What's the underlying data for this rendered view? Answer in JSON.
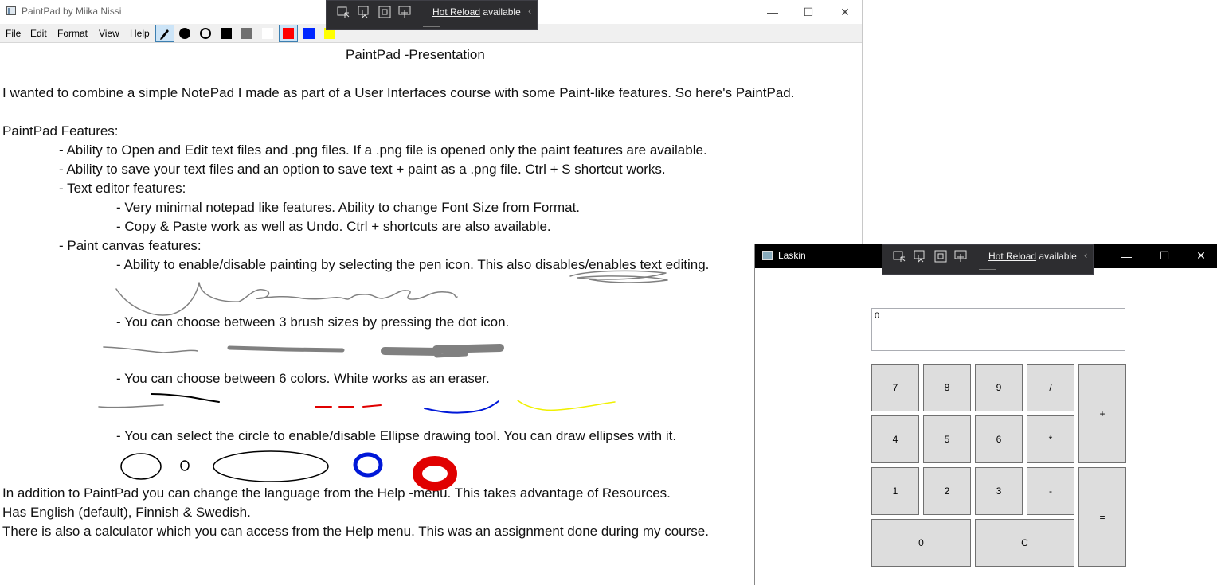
{
  "paintpad": {
    "window_title": "PaintPad by Miika Nissi",
    "controls": {
      "minimize": "—",
      "maximize": "☐",
      "close": "✕"
    },
    "menu": [
      "File",
      "Edit",
      "Format",
      "View",
      "Help"
    ],
    "tools": {
      "pen": "pen-icon",
      "brush_size": "dot-icon",
      "ellipse": "circle-icon",
      "colors": [
        "#000000",
        "#707070",
        "#ffffff",
        "#ff0000",
        "#0026ff",
        "#ffff00"
      ],
      "selected_color": "#ff0000"
    },
    "document": {
      "heading": "PaintPad -Presentation",
      "lines": [
        "I wanted to combine a simple NotePad I made as part of a User Interfaces course with some Paint-like features. So here's PaintPad.",
        "PaintPad Features:",
        "- Ability to Open and Edit text files and .png files. If a .png file is opened only the paint features are available.",
        "- Ability to save your text files and an option to save text + paint as a .png file. Ctrl + S shortcut works.",
        "- Text editor features:",
        "- Very minimal notepad like features. Ability to change Font Size from Format.",
        "- Copy & Paste work as well as Undo. Ctrl + shortcuts are also available.",
        "- Paint canvas features:",
        "- Ability to enable/disable painting by selecting the pen icon. This also disables/enables text editing.",
        "- You can choose between 3 brush sizes by pressing the dot icon.",
        "- You can choose between 6 colors. White works as an eraser.",
        "- You can select the circle to enable/disable Ellipse drawing tool. You can draw ellipses with it.",
        "In addition to PaintPad you can change the language from the Help -menu. This takes advantage of Resources.",
        "Has English (default), Finnish & Swedish.",
        "There is also a calculator which you can access from the Help menu. This was an assignment done during my course."
      ]
    }
  },
  "hot_reload": {
    "link": "Hot Reload",
    "text": "available",
    "icons": [
      "select-element-icon",
      "pointer-icon",
      "layout-adorner-icon",
      "track-focus-icon"
    ]
  },
  "laskin": {
    "window_title": "Laskin",
    "display": "0",
    "keys": [
      "7",
      "8",
      "9",
      "/",
      "+",
      "4",
      "5",
      "6",
      "*",
      "1",
      "2",
      "3",
      "-",
      "=",
      "0",
      "C"
    ]
  },
  "colors": {
    "paint_gray": "#808080",
    "paint_black": "#000000",
    "paint_red": "#e00000",
    "paint_blue": "#0018d8",
    "paint_yellow": "#f0f000"
  }
}
